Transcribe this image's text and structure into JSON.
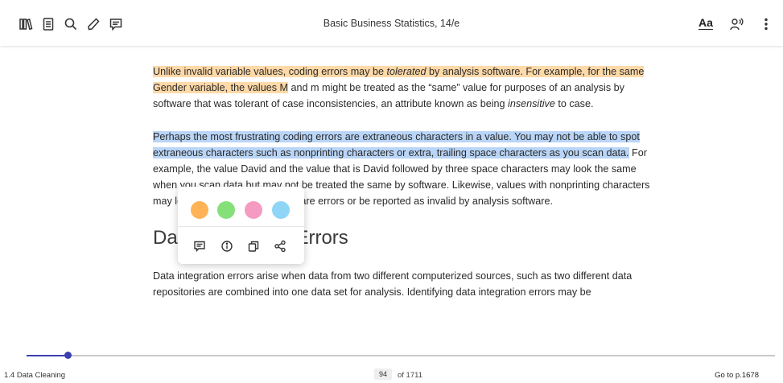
{
  "toolbar": {
    "book_title": "Basic Business Statistics, 14/e",
    "font_settings_label": "Aa",
    "icons": [
      "library-icon",
      "notebook-icon",
      "search-icon",
      "pencil-icon",
      "notes-icon",
      "read-aloud-icon",
      "more-options-icon"
    ]
  },
  "content": {
    "p1_highlight": "Unlike invalid variable values, coding errors may be ",
    "p1_highlight_italic": "tolerated",
    "p1_highlight_b": " by analysis software. For example, for the same Gender variable, the values M",
    "p1_rest": " and m might be treated as the “same” value for purposes of an analysis by software that was tolerant of case inconsistencies, an attribute known as being ",
    "p1_italic": "insensitive",
    "p1_end": " to case.",
    "p2_highlight": "Perhaps the most frustrating coding errors are extraneous characters in a value. You may not be able to spot extraneous characters such as nonprinting characters or extra, trailing space characters as you scan data.",
    "p2_rest": " For example, the value David and the value that is David followed by three space characters may look the same when you scan data but may not be treated the same by software. Likewise, values with nonprinting characters may look correct but cause software errors or be reported as invalid by analysis software.",
    "heading": "Data Integration Errors",
    "p3": "Data integration errors arise when data from two different computerized sources, such as two different data repositories are combined into one data set for analysis. Identifying data integration errors may be"
  },
  "popup": {
    "colors": [
      "#ffb357",
      "#86e07a",
      "#f59ac0",
      "#8fd5f7"
    ],
    "color_names": [
      "orange-swatch",
      "green-swatch",
      "pink-swatch",
      "blue-swatch"
    ],
    "actions": [
      "add-note-icon",
      "info-icon",
      "copy-icon",
      "share-icon"
    ]
  },
  "footer": {
    "chapter": "1.4 Data Cleaning",
    "current_page": "94",
    "total_pages": "of 1711",
    "goto": "Go to p.1678",
    "progress_fraction": 0.055
  },
  "colors": {
    "accent": "#3b3fae",
    "highlight_orange": "#ffd9a8",
    "highlight_blue": "#b9d5f7"
  }
}
